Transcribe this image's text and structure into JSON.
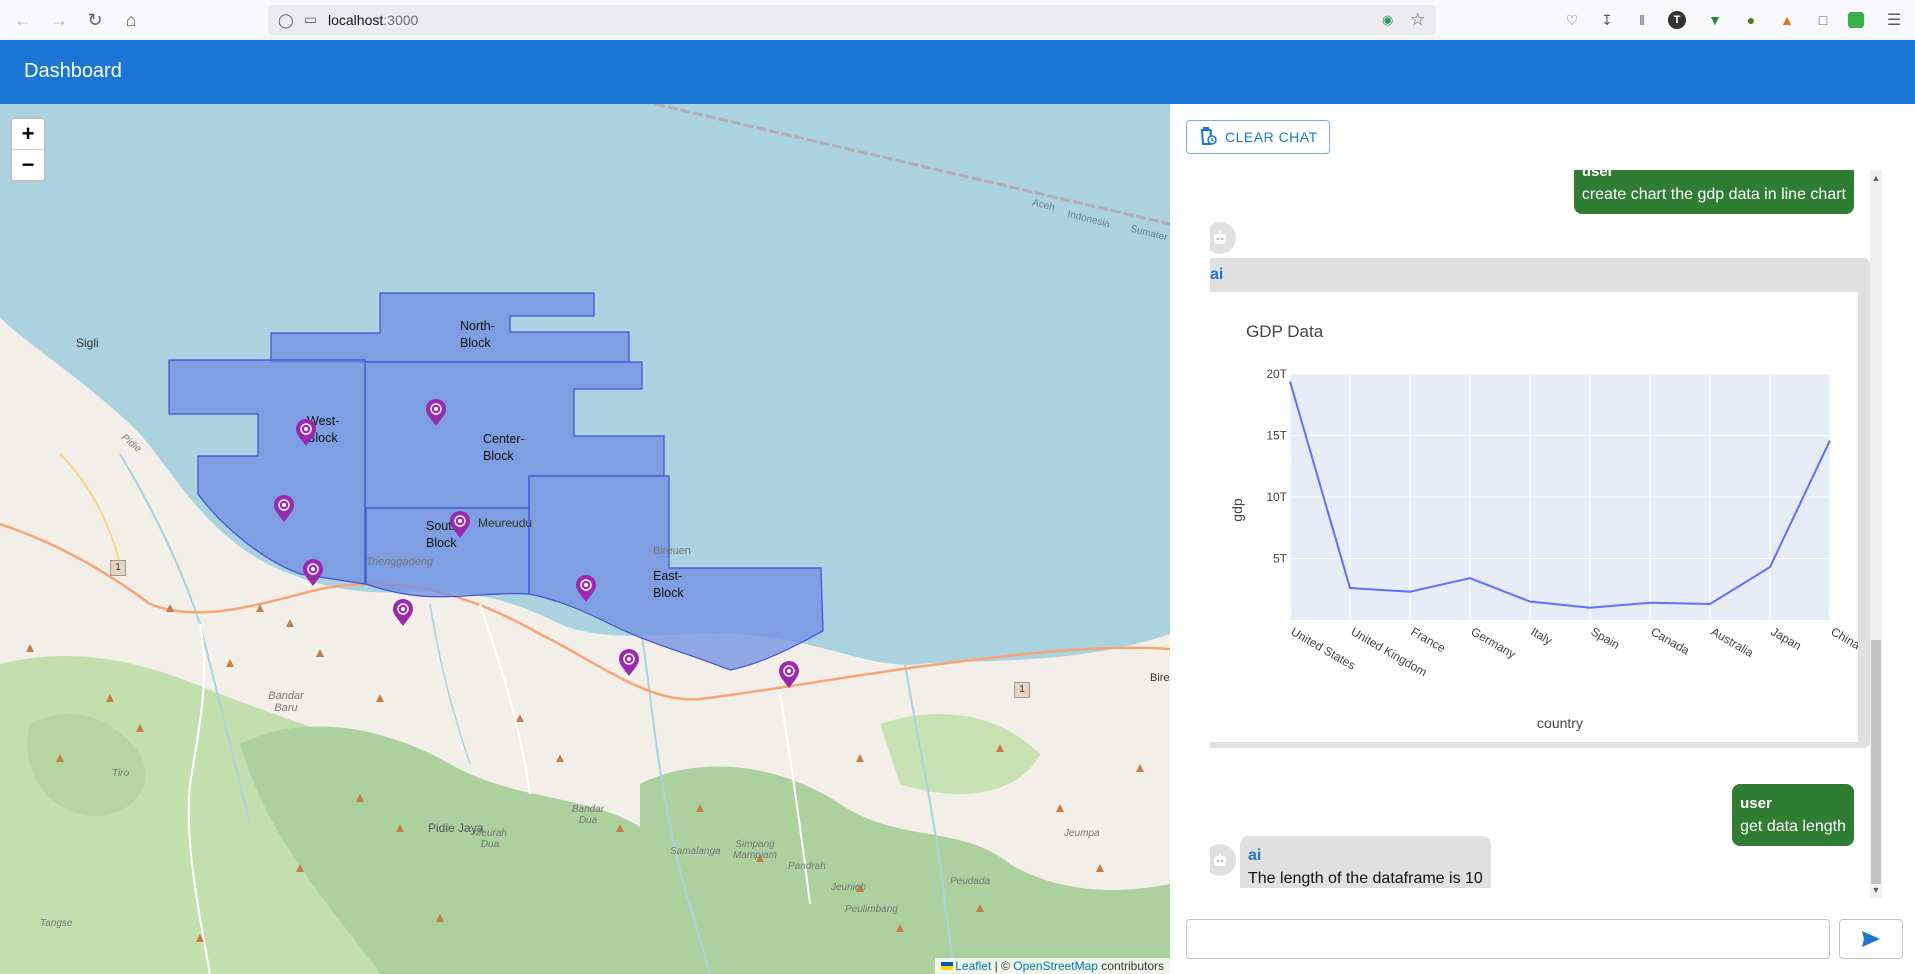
{
  "browser": {
    "url_host": "localhost",
    "url_port": ":3000",
    "extension_labels": [
      "T"
    ]
  },
  "app": {
    "title": "Dashboard"
  },
  "map": {
    "zoom_in_label": "+",
    "zoom_out_label": "−",
    "blocks": [
      {
        "name_line1": "North-",
        "name_line2": "Block"
      },
      {
        "name_line1": "West-",
        "name_line2": "Block"
      },
      {
        "name_line1": "Center-",
        "name_line2": "Block"
      },
      {
        "name_line1": "South-",
        "name_line2": "Block"
      },
      {
        "name_line1": "East-",
        "name_line2": "Block"
      }
    ],
    "place_labels": [
      "Sigli",
      "Meureudu",
      "Trienggadeng",
      "Bandar Baru",
      "Pidie Jaya",
      "Bireuen",
      "Samalanga",
      "Simpang Mampiam",
      "Peudada",
      "Jeumpa",
      "Peulimbang",
      "Jeunieb",
      "Pandrah",
      "Meurah Dua",
      "Bandar Dua",
      "Tiro",
      "Tangse",
      "Aceh",
      "Indonesia",
      "Sumater",
      "Bire",
      "Pidie",
      "1"
    ],
    "attribution": {
      "leaflet": "Leaflet",
      "separator": " | © ",
      "osm": "OpenStreetMap",
      "suffix": " contributors"
    },
    "marker_color": "#9c27b0",
    "polygon_color": "#6f8fe3"
  },
  "chat": {
    "clear_button_label": "CLEAR CHAT",
    "messages": [
      {
        "sender": "user",
        "text": "create chart the gdp data in line chart"
      },
      {
        "sender": "ai",
        "chart": true
      },
      {
        "sender": "user",
        "text": "get data length"
      },
      {
        "sender": "ai",
        "text": "The length of the dataframe is 10"
      }
    ],
    "input_placeholder": ""
  },
  "chart_data": {
    "type": "line",
    "title": "GDP Data",
    "xlabel": "country",
    "ylabel": "gdp",
    "categories": [
      "United States",
      "United Kingdom",
      "France",
      "Germany",
      "Italy",
      "Spain",
      "Canada",
      "Australia",
      "Japan",
      "China"
    ],
    "values": [
      19.4,
      2.6,
      2.3,
      3.4,
      1.5,
      1.0,
      1.4,
      1.3,
      4.3,
      14.6
    ],
    "unit": "T",
    "yticks": [
      "5T",
      "10T",
      "15T",
      "20T"
    ],
    "ylim": [
      0,
      20
    ],
    "grid": true,
    "line_color": "#636efa"
  }
}
